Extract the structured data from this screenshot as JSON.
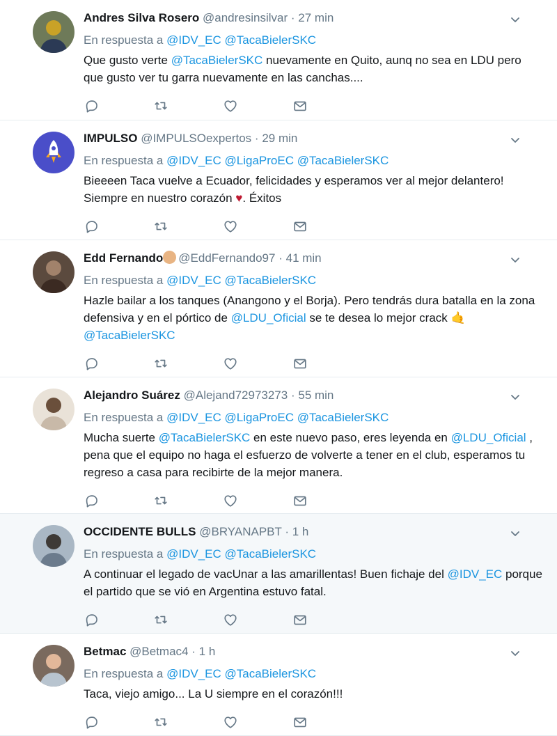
{
  "reply_prefix": "En respuesta a",
  "tweets": [
    {
      "name": "Andres Silva Rosero",
      "handle": "@andresinsilvar",
      "dot": "·",
      "time": "27 min",
      "mentions": [
        "@IDV_EC",
        "@TacaBielerSKC"
      ],
      "body": [
        {
          "t": "Que gusto verte "
        },
        {
          "m": "@TacaBielerSKC"
        },
        {
          "t": "  nuevamente en Quito, aunq no sea en LDU pero que gusto ver tu garra nuevamente en las canchas...."
        }
      ],
      "avatar_colors": [
        "#2b3a55",
        "#c9a227",
        "#6e7a59"
      ]
    },
    {
      "name": "IMPULSO",
      "handle": "@IMPULSOexpertos",
      "dot": "·",
      "time": "29 min",
      "mentions": [
        "@IDV_EC",
        "@LigaProEC",
        "@TacaBielerSKC"
      ],
      "body": [
        {
          "t": "Bieeeen Taca vuelve a Ecuador, felicidades y esperamos ver al mejor delantero! Siempre en nuestro corazón "
        },
        {
          "e": "♥"
        },
        {
          "t": ".  Éxitos"
        }
      ],
      "avatar_colors": [
        "#4a4ec9",
        "#f5a623",
        "#ffffff"
      ]
    },
    {
      "name": "Edd Fernando",
      "handle": "@EddFernando97",
      "dot": "·",
      "time": "41 min",
      "mentions": [
        "@IDV_EC",
        "@TacaBielerSKC"
      ],
      "body": [
        {
          "t": "Hazle bailar a los tanques (Anangono y el Borja). Pero tendrás dura batalla en la zona defensiva y en el pórtico de "
        },
        {
          "m": "@LDU_Oficial"
        },
        {
          "t": " se te desea lo mejor crack "
        },
        {
          "e2": "🤙"
        },
        {
          "br": true
        },
        {
          "m": "@TacaBielerSKC"
        }
      ],
      "avatar_colors": [
        "#3b2a22",
        "#a1826b",
        "#5b4a3e"
      ]
    },
    {
      "name": "Alejandro Suárez",
      "handle": "@Alejand72973273",
      "dot": "·",
      "time": "55 min",
      "mentions": [
        "@IDV_EC",
        "@LigaProEC",
        "@TacaBielerSKC"
      ],
      "body": [
        {
          "t": "Mucha suerte "
        },
        {
          "m": "@TacaBielerSKC"
        },
        {
          "t": "  en este nuevo paso, eres leyenda en "
        },
        {
          "m": "@LDU_Oficial"
        },
        {
          "t": " , pena que el equipo no haga el esfuerzo de volverte a tener en el club, esperamos tu regreso a casa para recibirte de la mejor manera."
        }
      ],
      "avatar_colors": [
        "#c8b9a8",
        "#6a4f3b",
        "#e9e2d8"
      ]
    },
    {
      "name": "OCCIDENTE BULLS",
      "handle": "@BRYANAPBT",
      "dot": "·",
      "time": "1 h",
      "mentions": [
        "@IDV_EC",
        "@TacaBielerSKC"
      ],
      "body": [
        {
          "t": "A continuar el legado de vacUnar a las amarillentas! Buen fichaje del "
        },
        {
          "m": "@IDV_EC"
        },
        {
          "t": " porque el partido que se vió en Argentina estuvo fatal."
        }
      ],
      "avatar_colors": [
        "#6b7b8c",
        "#3e3a36",
        "#a9b7c4"
      ]
    },
    {
      "name": "Betmac",
      "handle": "@Betmac4",
      "dot": "·",
      "time": "1 h",
      "mentions": [
        "@IDV_EC",
        "@TacaBielerSKC"
      ],
      "body": [
        {
          "t": "Taca, viejo amigo... La U siempre en el corazón!!!"
        }
      ],
      "avatar_colors": [
        "#b8c4cf",
        "#e2b89a",
        "#7a6a5e"
      ]
    }
  ]
}
